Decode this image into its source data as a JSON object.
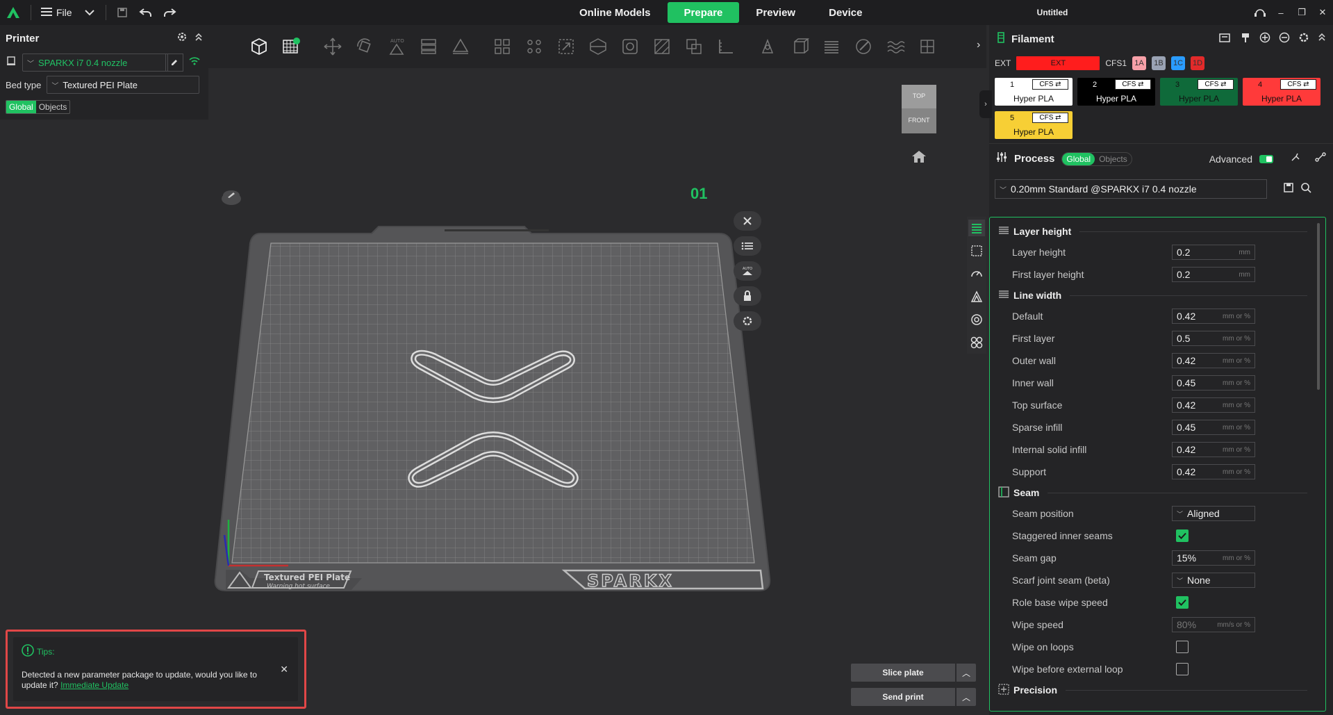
{
  "topbar": {
    "file_label": "File",
    "tabs": [
      "Online Models",
      "Prepare",
      "Preview",
      "Device"
    ],
    "active_tab": "Prepare",
    "title": "Untitled",
    "colors": {
      "accent": "#20c161",
      "bg": "#1e1e20"
    }
  },
  "printer": {
    "title": "Printer",
    "name": "SPARKX i7 0.4 nozzle",
    "bed_type_label": "Bed type",
    "bed_type": "Textured PEI Plate",
    "scope_global": "Global",
    "scope_objects": "Objects"
  },
  "viewport": {
    "cube_top": "TOP",
    "cube_front": "FRONT",
    "plate_number": "01",
    "plate_logo_text": "SPARKX",
    "plate_label_line1": "Textured PEI Plate",
    "plate_label_line2": "Warning hot surface"
  },
  "tips": {
    "label": "Tips:",
    "message": "Detected a new parameter package to update, would you like to update it?",
    "link": "Immediate Update"
  },
  "actions": {
    "slice": "Slice plate",
    "send": "Send print"
  },
  "filament": {
    "title": "Filament",
    "ext_label": "EXT",
    "ext_chip": "EXT",
    "cfs_label": "CFS1",
    "slots": [
      {
        "label": "1A",
        "color": "#f7a0a8"
      },
      {
        "label": "1B",
        "color": "#9aa3b4"
      },
      {
        "label": "1C",
        "color": "#2a9cff"
      },
      {
        "label": "1D",
        "color": "#e22a2a"
      }
    ],
    "cfs_tag": "CFS ⇄",
    "items": [
      {
        "num": "1",
        "name": "Hyper PLA",
        "color": "#ffffff",
        "text": "#111111"
      },
      {
        "num": "2",
        "name": "Hyper PLA",
        "color": "#000000",
        "text": "#ffffff"
      },
      {
        "num": "3",
        "name": "Hyper PLA",
        "color": "#0f6a3a",
        "text": "#111111"
      },
      {
        "num": "4",
        "name": "Hyper PLA",
        "color": "#ff3a3a",
        "text": "#111111"
      },
      {
        "num": "5",
        "name": "Hyper PLA",
        "color": "#f7cf35",
        "text": "#111111"
      }
    ]
  },
  "process": {
    "title": "Process",
    "scope_global": "Global",
    "scope_objects": "Objects",
    "advanced_label": "Advanced",
    "preset": "0.20mm Standard @SPARKX i7 0.4 nozzle",
    "groups": {
      "layer_height": "Layer height",
      "line_width": "Line width",
      "seam": "Seam",
      "precision": "Precision"
    },
    "params": {
      "layer_height": {
        "label": "Layer height",
        "value": "0.2",
        "unit": "mm"
      },
      "first_layer_height": {
        "label": "First layer height",
        "value": "0.2",
        "unit": "mm"
      },
      "default": {
        "label": "Default",
        "value": "0.42",
        "unit": "mm or %"
      },
      "first_layer": {
        "label": "First layer",
        "value": "0.5",
        "unit": "mm or %"
      },
      "outer_wall": {
        "label": "Outer wall",
        "value": "0.42",
        "unit": "mm or %"
      },
      "inner_wall": {
        "label": "Inner wall",
        "value": "0.45",
        "unit": "mm or %"
      },
      "top_surface": {
        "label": "Top surface",
        "value": "0.42",
        "unit": "mm or %"
      },
      "sparse_infill": {
        "label": "Sparse infill",
        "value": "0.45",
        "unit": "mm or %"
      },
      "internal_solid_infill": {
        "label": "Internal solid infill",
        "value": "0.42",
        "unit": "mm or %"
      },
      "support": {
        "label": "Support",
        "value": "0.42",
        "unit": "mm or %"
      },
      "seam_position": {
        "label": "Seam position",
        "value": "Aligned"
      },
      "staggered": {
        "label": "Staggered inner seams",
        "checked": true
      },
      "seam_gap": {
        "label": "Seam gap",
        "value": "15%",
        "unit": "mm or %"
      },
      "scarf": {
        "label": "Scarf joint seam (beta)",
        "value": "None"
      },
      "role_wipe": {
        "label": "Role base wipe speed",
        "checked": true
      },
      "wipe_speed": {
        "label": "Wipe speed",
        "value": "80%",
        "unit": "mm/s or %"
      },
      "wipe_loops": {
        "label": "Wipe on loops",
        "checked": false
      },
      "wipe_before": {
        "label": "Wipe before external loop",
        "checked": false
      }
    }
  }
}
